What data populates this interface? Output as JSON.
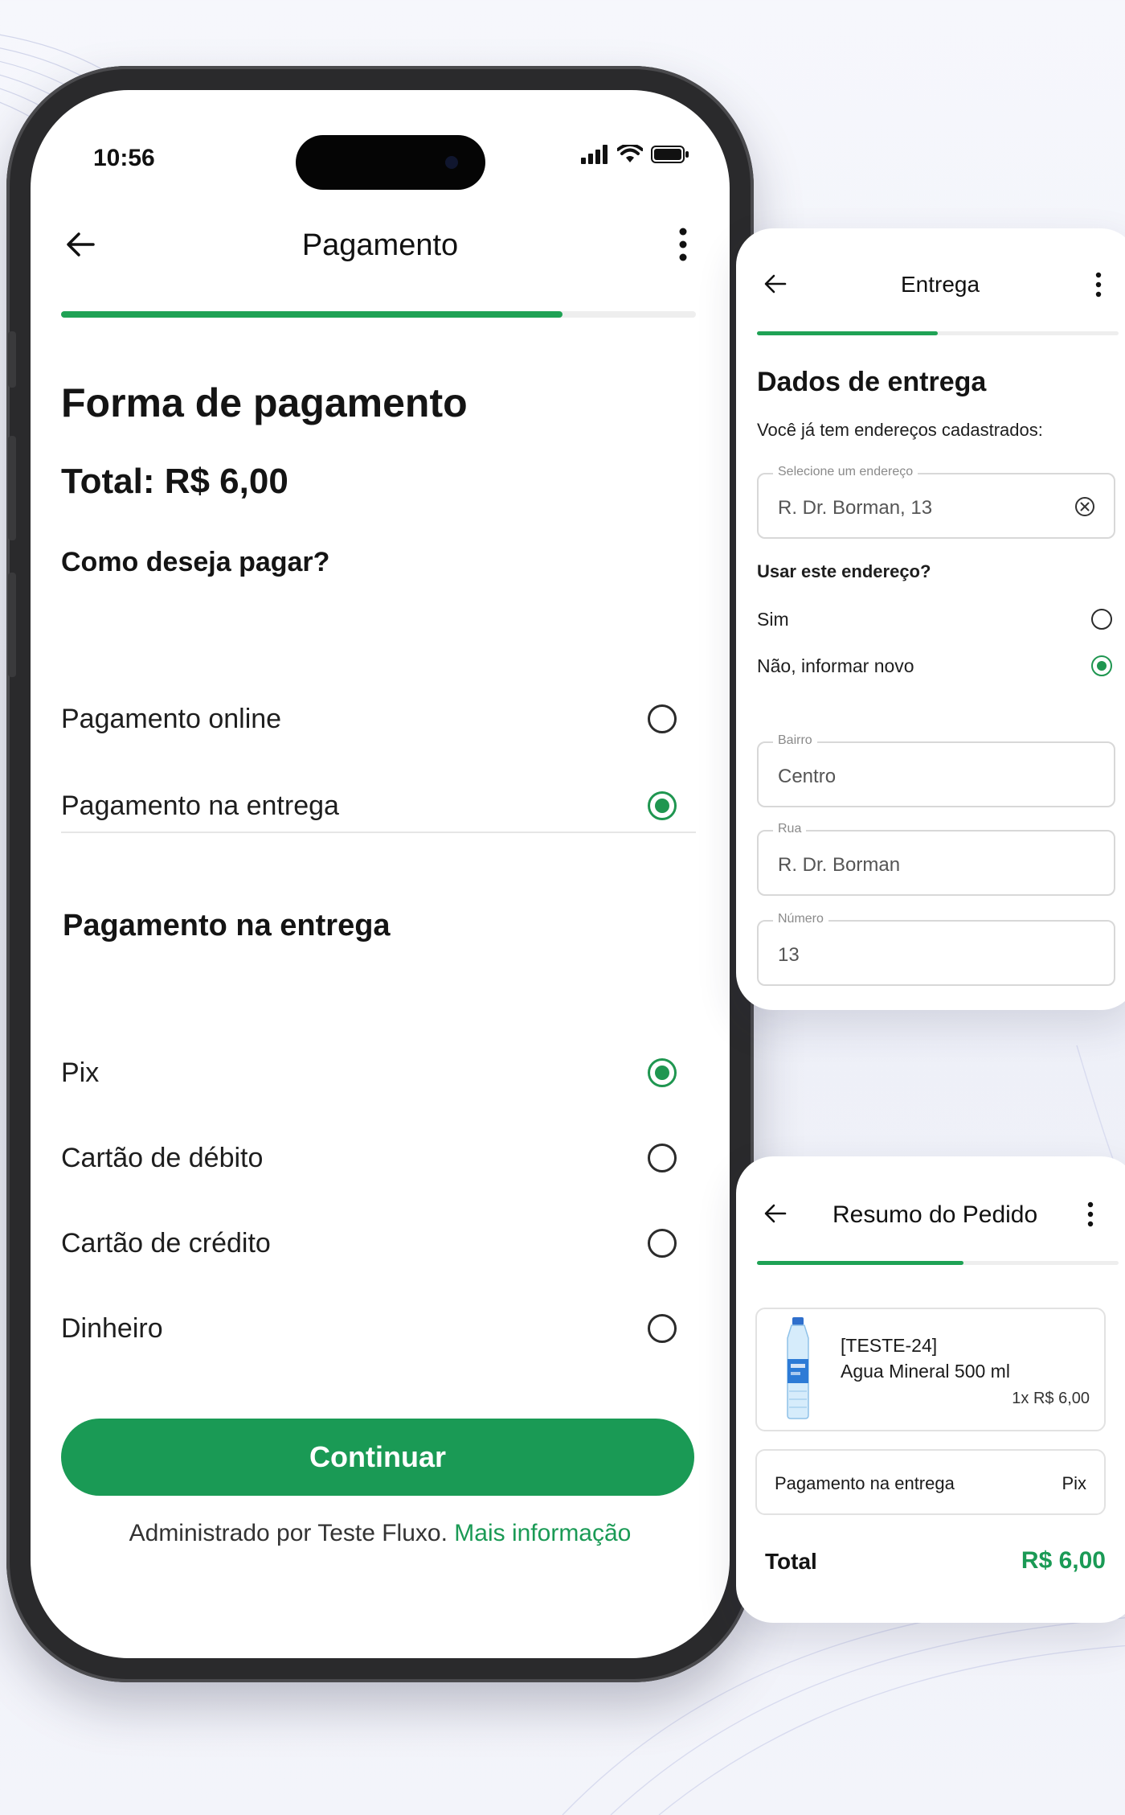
{
  "colors": {
    "accent": "#1a9a55",
    "progress": "#1fa255",
    "text": "#141414"
  },
  "phone": {
    "status_time": "10:56",
    "icons": [
      "signal-icon",
      "wifi-icon",
      "battery-icon"
    ],
    "header": {
      "title": "Pagamento",
      "back_icon": "arrow-left-icon",
      "more_icon": "more-vertical-icon"
    },
    "progress": 0.79,
    "title": "Forma de pagamento",
    "total": "Total: R$ 6,00",
    "question": "Como deseja pagar?",
    "payment_methods": [
      {
        "label": "Pagamento online",
        "selected": false
      },
      {
        "label": "Pagamento na entrega",
        "selected": true
      }
    ],
    "delivery_section_title": "Pagamento na entrega",
    "delivery_options": [
      {
        "label": "Pix",
        "selected": true
      },
      {
        "label": "Cartão de débito",
        "selected": false
      },
      {
        "label": "Cartão de crédito",
        "selected": false
      },
      {
        "label": "Dinheiro",
        "selected": false
      }
    ],
    "cta_label": "Continuar",
    "footer_text": "Administrado por Teste Fluxo.",
    "footer_link": "Mais informação"
  },
  "entrega": {
    "header_title": "Entrega",
    "progress": 0.5,
    "title": "Dados de entrega",
    "intro": "Você já tem endereços cadastrados:",
    "select_label": "Selecione um endereço",
    "select_value": "R. Dr. Borman, 13",
    "question": "Usar este endereço?",
    "options": [
      {
        "label": "Sim",
        "selected": false
      },
      {
        "label": "Não, informar novo",
        "selected": true
      }
    ],
    "fields": [
      {
        "label": "Bairro",
        "value": "Centro"
      },
      {
        "label": "Rua",
        "value": "R. Dr. Borman"
      },
      {
        "label": "Número",
        "value": "13"
      }
    ]
  },
  "resumo": {
    "header_title": "Resumo do Pedido",
    "progress": 0.57,
    "product_code": "[TESTE-24]",
    "product_name": "Agua Mineral 500 ml",
    "product_qty_price": "1x  R$ 6,00",
    "payment_label": "Pagamento na entrega",
    "payment_method": "Pix",
    "total_label": "Total",
    "total_value": "R$ 6,00"
  }
}
